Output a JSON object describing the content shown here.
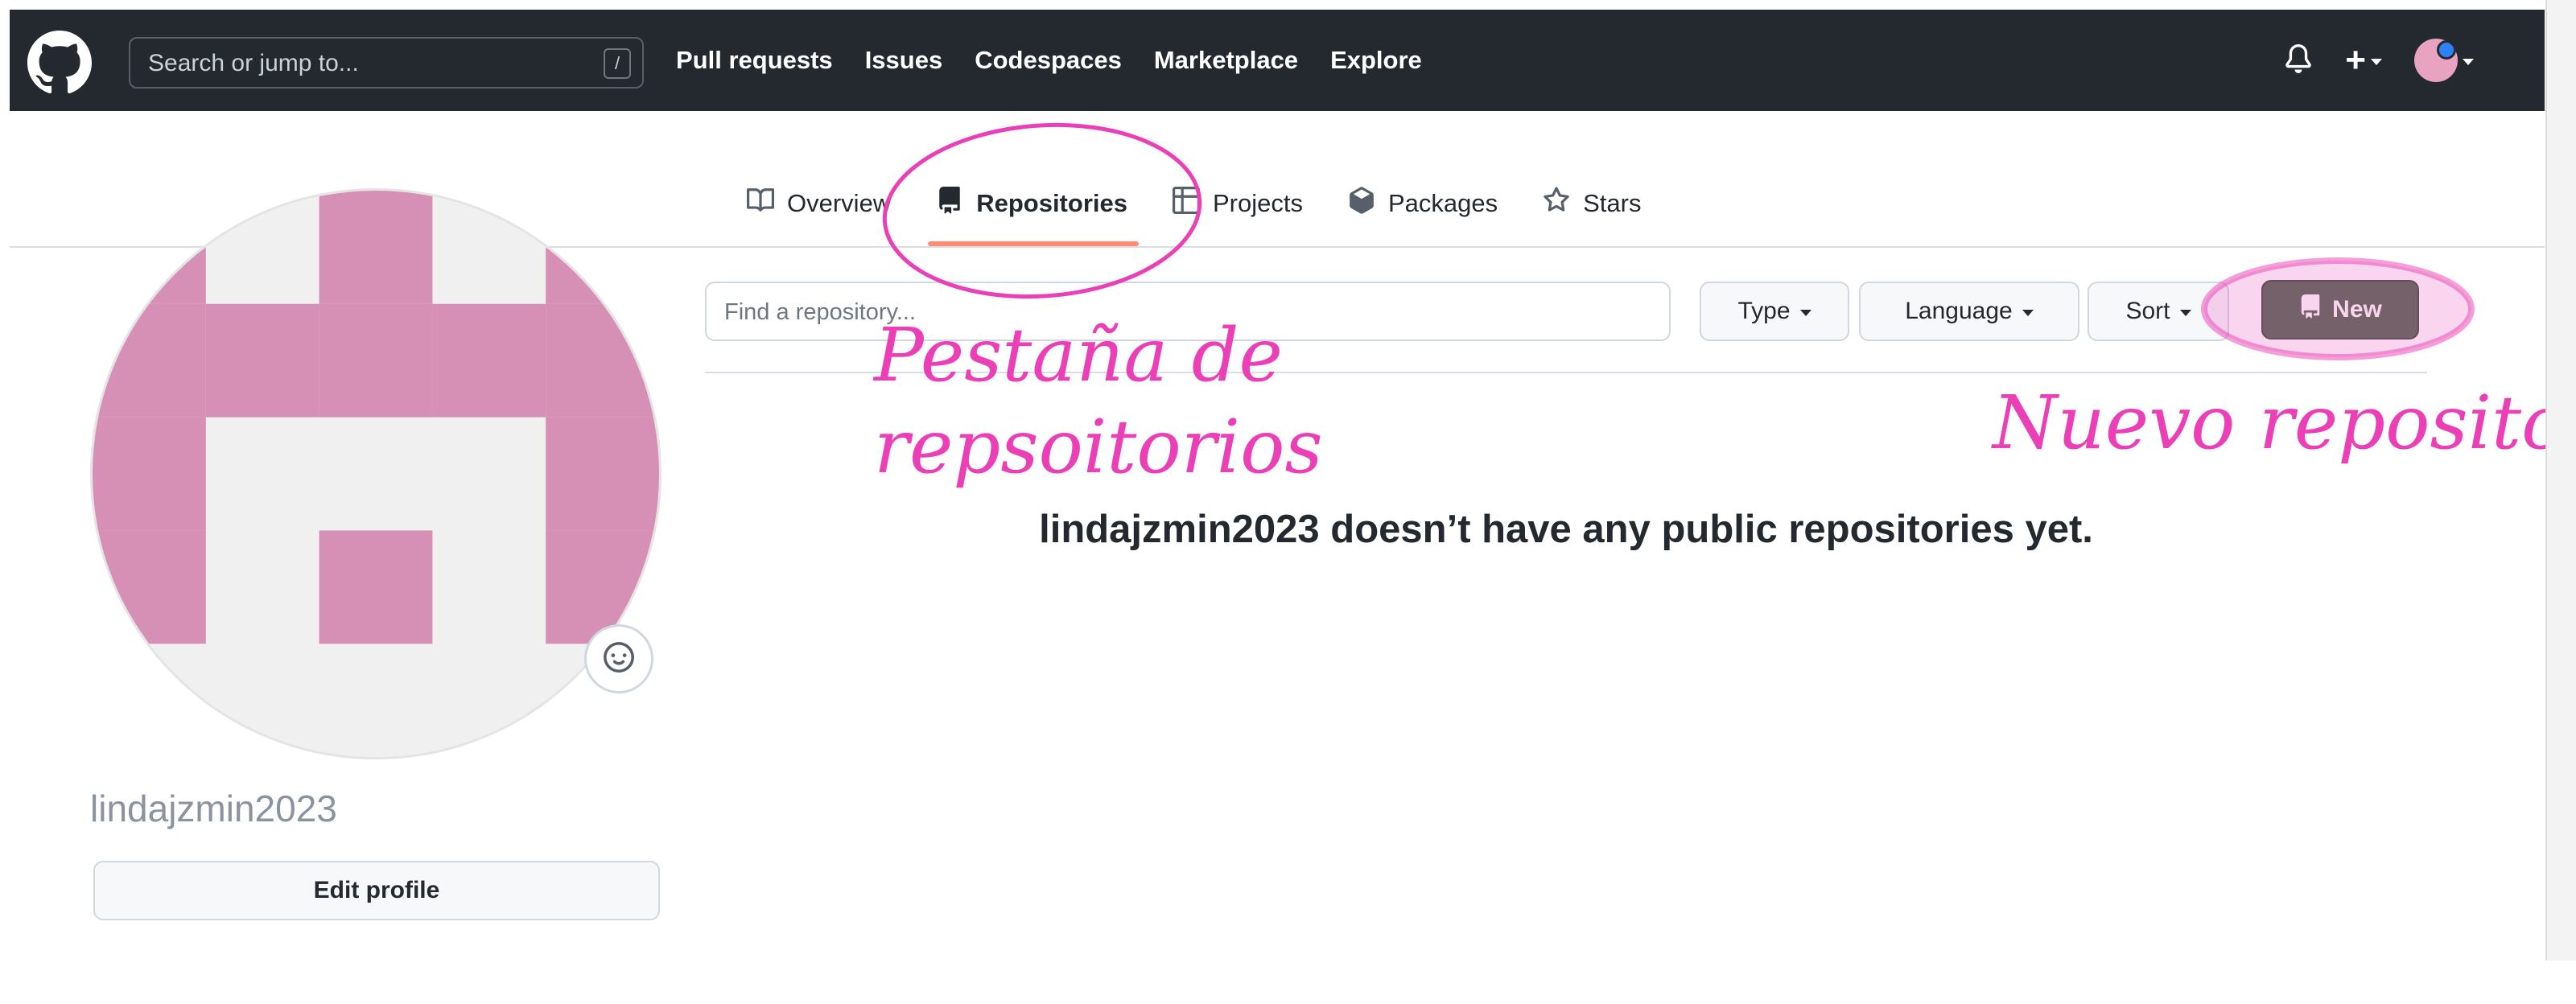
{
  "header": {
    "search_placeholder": "Search or jump to...",
    "search_key_hint": "/",
    "nav": [
      "Pull requests",
      "Issues",
      "Codespaces",
      "Marketplace",
      "Explore"
    ],
    "plus_label": "+"
  },
  "profile": {
    "username": "lindajzmin2023",
    "edit_label": "Edit profile",
    "avatar_color": "#d68fb5"
  },
  "tabs": [
    {
      "label": "Overview",
      "icon": "book-icon"
    },
    {
      "label": "Repositories",
      "icon": "repo-icon",
      "selected": true
    },
    {
      "label": "Projects",
      "icon": "table-icon"
    },
    {
      "label": "Packages",
      "icon": "package-icon"
    },
    {
      "label": "Stars",
      "icon": "star-icon"
    }
  ],
  "repos": {
    "find_placeholder": "Find a repository...",
    "type_label": "Type",
    "language_label": "Language",
    "sort_label": "Sort",
    "new_label": "New",
    "empty_message": "lindajzmin2023 doesn’t have any public repositories yet."
  },
  "annotations": {
    "tab_note_line1": "Pestaña de",
    "tab_note_line2": "repsoitorios",
    "new_note": "Nuevo repositorio"
  },
  "colors": {
    "header_bg": "#24292f",
    "annotation": "#ea3fb6",
    "new_button": "#556b55",
    "tab_underline": "#fd8c73"
  }
}
